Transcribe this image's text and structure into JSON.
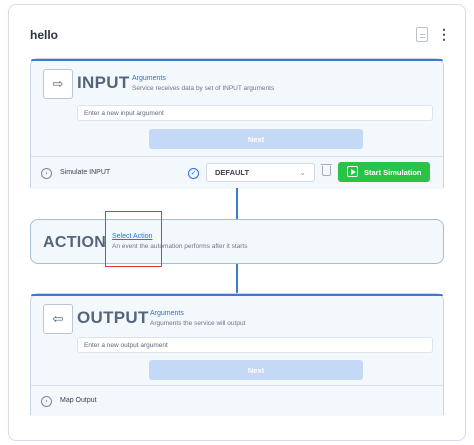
{
  "card": {
    "title": "hello",
    "file_icon": "file-icon",
    "menu_icon": "kebab-menu-icon"
  },
  "input_section": {
    "heading": "INPUT",
    "icon": "input-arrow-icon",
    "link": "Arguments",
    "description": "Service receives data by set of INPUT arguments",
    "field_placeholder": "Enter a new input argument",
    "next_label": "Next",
    "simulate_label": "Simulate INPUT",
    "select_value": "DEFAULT",
    "start_label": "Start Simulation"
  },
  "action_section": {
    "heading": "ACTION",
    "link": "Select Action",
    "description": "An event the automation performs after it starts"
  },
  "output_section": {
    "heading": "OUTPUT",
    "icon": "output-arrow-icon",
    "link": "Arguments",
    "description": "Arguments the service will output",
    "field_placeholder": "Enter a new output argument",
    "next_label": "Next",
    "map_label": "Map Output"
  },
  "colors": {
    "accent": "#2d6fd6",
    "start_button": "#27c446",
    "next_button_disabled": "#c3d9f6",
    "highlight": "#d93a3a"
  }
}
